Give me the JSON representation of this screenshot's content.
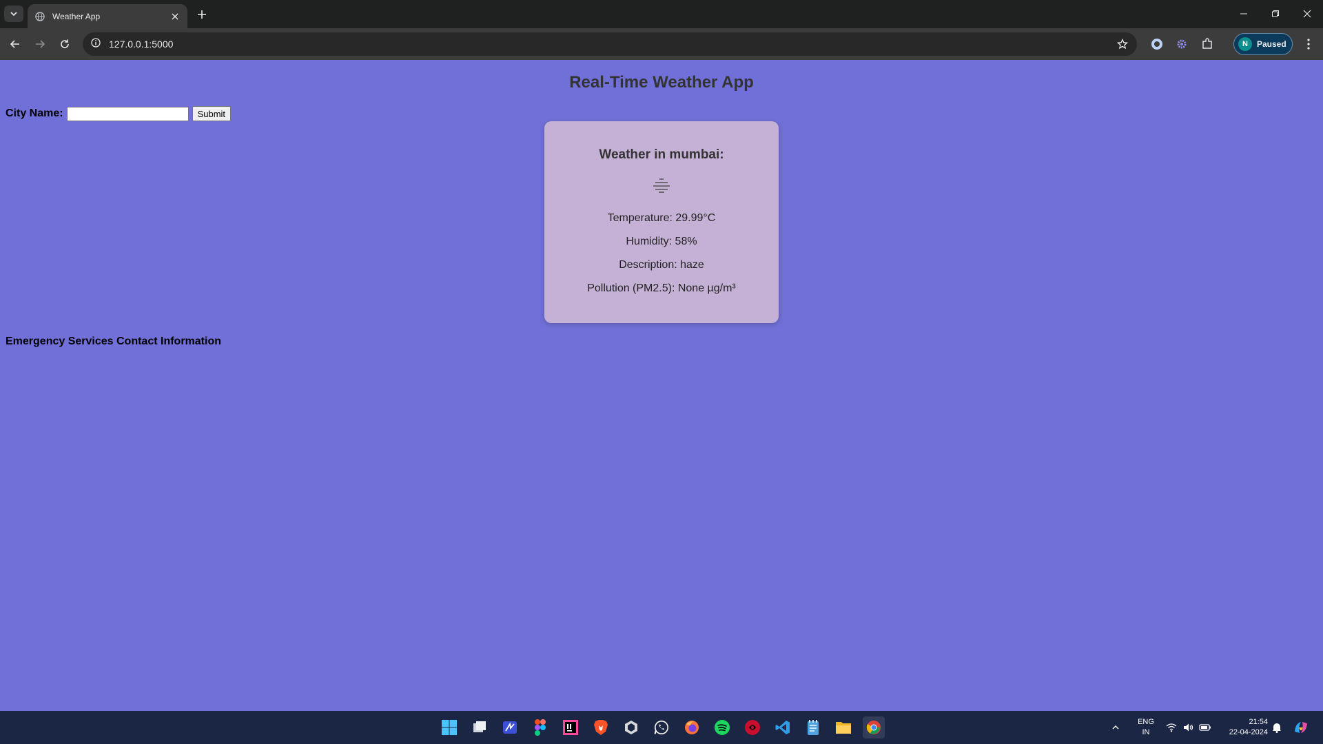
{
  "browser": {
    "tab_title": "Weather App",
    "url": "127.0.0.1:5000",
    "profile_initial": "N",
    "profile_status": "Paused"
  },
  "page": {
    "title": "Real-Time Weather App",
    "form": {
      "label": "City Name:",
      "input_value": "",
      "submit_label": "Submit"
    },
    "card": {
      "heading": "Weather in mumbai:",
      "icon": "haze-icon",
      "temperature": "Temperature: 29.99°C",
      "humidity": "Humidity: 58%",
      "description": "Description: haze",
      "pollution": "Pollution (PM2.5): None µg/m³"
    },
    "emergency_heading": "Emergency Services Contact Information"
  },
  "taskbar": {
    "lang_top": "ENG",
    "lang_bottom": "IN",
    "time": "21:54",
    "date": "22-04-2024",
    "apps": [
      "windows-start-icon",
      "task-view-icon",
      "notes-icon",
      "figma-icon",
      "intellij-icon",
      "brave-icon",
      "unity-icon",
      "whatsapp-icon",
      "firefox-icon",
      "spotify-icon",
      "app-icon",
      "vscode-icon",
      "notepad-icon",
      "file-explorer-icon",
      "chrome-icon"
    ]
  },
  "colors": {
    "page_background": "#7070d8",
    "card_background": "#c5b0d6",
    "browser_dark": "#1f2020",
    "taskbar": "#1b2544"
  }
}
